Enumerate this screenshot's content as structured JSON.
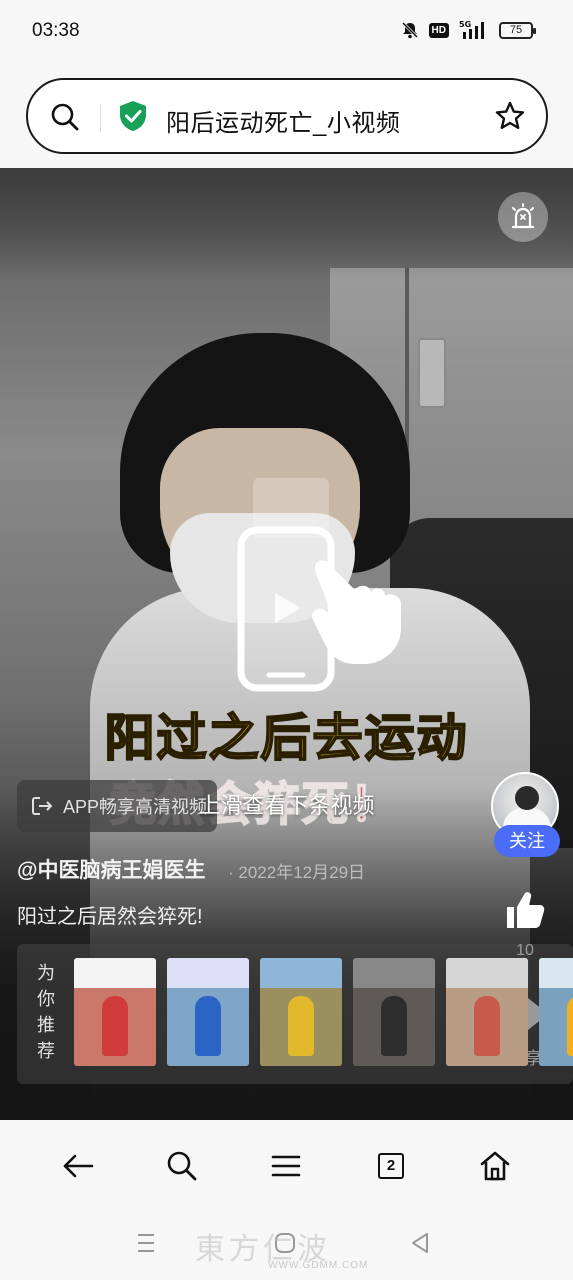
{
  "status_bar": {
    "time": "03:38",
    "hd": "HD",
    "network": "5G",
    "battery": "75"
  },
  "address_bar": {
    "title": "阳后运动死亡_小视频",
    "search_icon": "search-icon",
    "secure_icon": "shield-check-icon",
    "bookmark_icon": "star-icon"
  },
  "video": {
    "caption_line1": "阳过之后去运动",
    "caption_line2": "竟然会猝死！",
    "swipe_hint": "上滑查看下条视频",
    "app_prompt": "APP畅享高清视频",
    "author": "@中医脑病王娟医生",
    "date": "· 2022年12月29日",
    "description": "阳过之后居然会猝死!",
    "follow_label": "关注",
    "like_count": "10",
    "share_label": "分享",
    "accent_color": "#4a6cf7"
  },
  "recommend": {
    "label_chars": [
      "为",
      "你",
      "推",
      "荐"
    ],
    "thumbs": [
      {
        "top": "#f3f3f3",
        "body": "#c9786a",
        "fig": "#d23b3b"
      },
      {
        "top": "#dcdff5",
        "body": "#7fa6c8",
        "fig": "#2a64c5"
      },
      {
        "top": "#8fb6d8",
        "body": "#9b8f60",
        "fig": "#e1b92a"
      },
      {
        "top": "#888888",
        "body": "#5e5a55",
        "fig": "#2e2e2e"
      },
      {
        "top": "#d6d6d6",
        "body": "#b89c84",
        "fig": "#c75a4a"
      },
      {
        "top": "#d8e6f0",
        "body": "#7aa1bd",
        "fig": "#f0b020"
      }
    ]
  },
  "bottom_nav": {
    "back_icon": "back-arrow-icon",
    "search_icon": "search-icon",
    "menu_icon": "menu-icon",
    "tabs_count": "2",
    "home_icon": "home-icon"
  },
  "system_bar": {
    "watermark": "東方仁波",
    "watermark_sub": "WWW.GDMM.COM"
  }
}
